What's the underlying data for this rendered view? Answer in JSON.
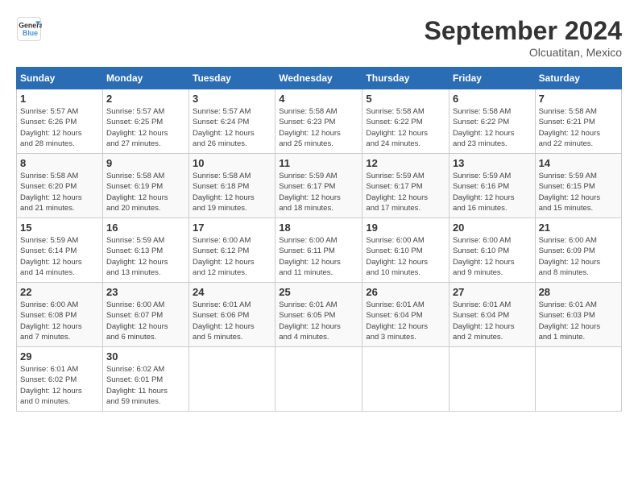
{
  "logo": {
    "line1": "General",
    "line2": "Blue"
  },
  "title": "September 2024",
  "location": "Olcuatitan, Mexico",
  "days_header": [
    "Sunday",
    "Monday",
    "Tuesday",
    "Wednesday",
    "Thursday",
    "Friday",
    "Saturday"
  ],
  "weeks": [
    [
      {
        "day": "1",
        "sunrise": "5:57 AM",
        "sunset": "6:26 PM",
        "daylight": "12 hours and 28 minutes."
      },
      {
        "day": "2",
        "sunrise": "5:57 AM",
        "sunset": "6:25 PM",
        "daylight": "12 hours and 27 minutes."
      },
      {
        "day": "3",
        "sunrise": "5:57 AM",
        "sunset": "6:24 PM",
        "daylight": "12 hours and 26 minutes."
      },
      {
        "day": "4",
        "sunrise": "5:58 AM",
        "sunset": "6:23 PM",
        "daylight": "12 hours and 25 minutes."
      },
      {
        "day": "5",
        "sunrise": "5:58 AM",
        "sunset": "6:22 PM",
        "daylight": "12 hours and 24 minutes."
      },
      {
        "day": "6",
        "sunrise": "5:58 AM",
        "sunset": "6:22 PM",
        "daylight": "12 hours and 23 minutes."
      },
      {
        "day": "7",
        "sunrise": "5:58 AM",
        "sunset": "6:21 PM",
        "daylight": "12 hours and 22 minutes."
      }
    ],
    [
      {
        "day": "8",
        "sunrise": "5:58 AM",
        "sunset": "6:20 PM",
        "daylight": "12 hours and 21 minutes."
      },
      {
        "day": "9",
        "sunrise": "5:58 AM",
        "sunset": "6:19 PM",
        "daylight": "12 hours and 20 minutes."
      },
      {
        "day": "10",
        "sunrise": "5:58 AM",
        "sunset": "6:18 PM",
        "daylight": "12 hours and 19 minutes."
      },
      {
        "day": "11",
        "sunrise": "5:59 AM",
        "sunset": "6:17 PM",
        "daylight": "12 hours and 18 minutes."
      },
      {
        "day": "12",
        "sunrise": "5:59 AM",
        "sunset": "6:17 PM",
        "daylight": "12 hours and 17 minutes."
      },
      {
        "day": "13",
        "sunrise": "5:59 AM",
        "sunset": "6:16 PM",
        "daylight": "12 hours and 16 minutes."
      },
      {
        "day": "14",
        "sunrise": "5:59 AM",
        "sunset": "6:15 PM",
        "daylight": "12 hours and 15 minutes."
      }
    ],
    [
      {
        "day": "15",
        "sunrise": "5:59 AM",
        "sunset": "6:14 PM",
        "daylight": "12 hours and 14 minutes."
      },
      {
        "day": "16",
        "sunrise": "5:59 AM",
        "sunset": "6:13 PM",
        "daylight": "12 hours and 13 minutes."
      },
      {
        "day": "17",
        "sunrise": "6:00 AM",
        "sunset": "6:12 PM",
        "daylight": "12 hours and 12 minutes."
      },
      {
        "day": "18",
        "sunrise": "6:00 AM",
        "sunset": "6:11 PM",
        "daylight": "12 hours and 11 minutes."
      },
      {
        "day": "19",
        "sunrise": "6:00 AM",
        "sunset": "6:10 PM",
        "daylight": "12 hours and 10 minutes."
      },
      {
        "day": "20",
        "sunrise": "6:00 AM",
        "sunset": "6:10 PM",
        "daylight": "12 hours and 9 minutes."
      },
      {
        "day": "21",
        "sunrise": "6:00 AM",
        "sunset": "6:09 PM",
        "daylight": "12 hours and 8 minutes."
      }
    ],
    [
      {
        "day": "22",
        "sunrise": "6:00 AM",
        "sunset": "6:08 PM",
        "daylight": "12 hours and 7 minutes."
      },
      {
        "day": "23",
        "sunrise": "6:00 AM",
        "sunset": "6:07 PM",
        "daylight": "12 hours and 6 minutes."
      },
      {
        "day": "24",
        "sunrise": "6:01 AM",
        "sunset": "6:06 PM",
        "daylight": "12 hours and 5 minutes."
      },
      {
        "day": "25",
        "sunrise": "6:01 AM",
        "sunset": "6:05 PM",
        "daylight": "12 hours and 4 minutes."
      },
      {
        "day": "26",
        "sunrise": "6:01 AM",
        "sunset": "6:04 PM",
        "daylight": "12 hours and 3 minutes."
      },
      {
        "day": "27",
        "sunrise": "6:01 AM",
        "sunset": "6:04 PM",
        "daylight": "12 hours and 2 minutes."
      },
      {
        "day": "28",
        "sunrise": "6:01 AM",
        "sunset": "6:03 PM",
        "daylight": "12 hours and 1 minute."
      }
    ],
    [
      {
        "day": "29",
        "sunrise": "6:01 AM",
        "sunset": "6:02 PM",
        "daylight": "12 hours and 0 minutes."
      },
      {
        "day": "30",
        "sunrise": "6:02 AM",
        "sunset": "6:01 PM",
        "daylight": "11 hours and 59 minutes."
      },
      null,
      null,
      null,
      null,
      null
    ]
  ]
}
